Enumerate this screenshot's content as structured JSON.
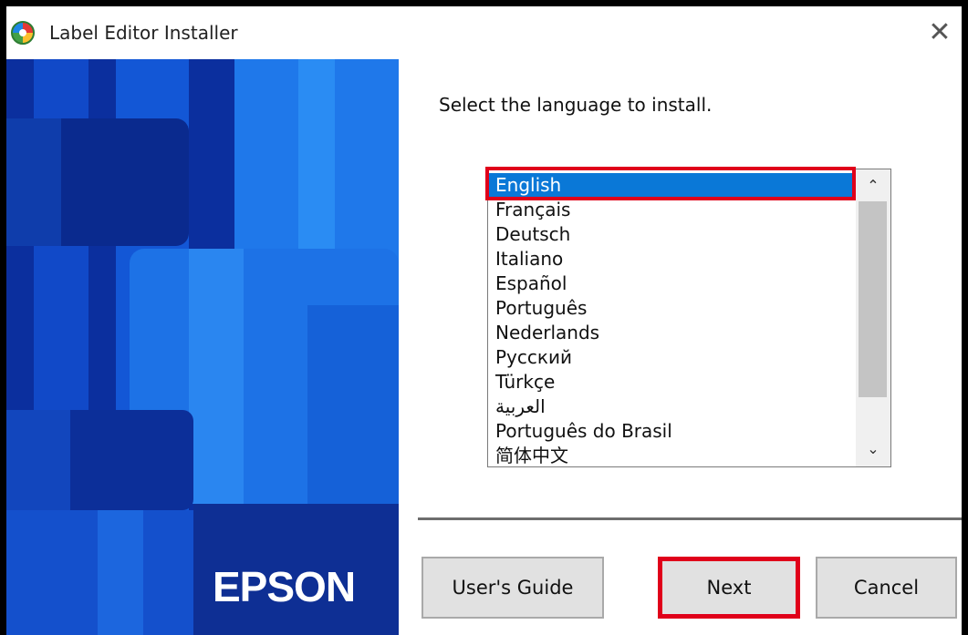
{
  "window": {
    "title": "Label Editor Installer",
    "close_glyph": "✕",
    "icon": "label-editor-app-icon"
  },
  "banner": {
    "brand": "EPSON",
    "colors": [
      "#0a2a9a",
      "#1565d8",
      "#2b8cf0",
      "#0d47a1"
    ]
  },
  "main": {
    "prompt": "Select the language to install.",
    "languages": [
      "English",
      "Français",
      "Deutsch",
      "Italiano",
      "Español",
      "Português",
      "Nederlands",
      "Русский",
      "Türkçe",
      "العربية",
      "Português do Brasil",
      "简体中文"
    ],
    "selected_index": 0,
    "scroll_up_glyph": "⌃",
    "scroll_down_glyph": "⌄"
  },
  "buttons": {
    "guide": "User's Guide",
    "next": "Next",
    "cancel": "Cancel"
  },
  "colors": {
    "selection": "#0a78d7",
    "highlight_outline": "#e0001a"
  }
}
